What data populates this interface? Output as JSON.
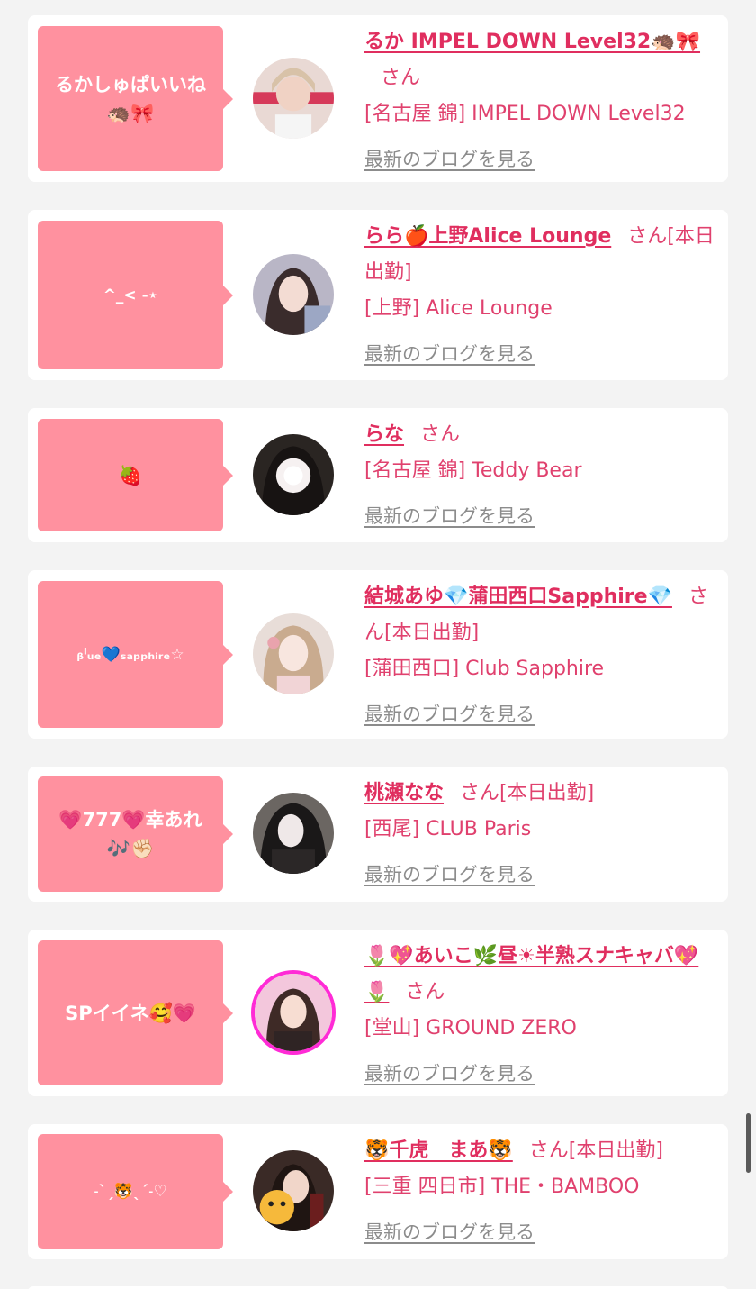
{
  "blog_link_label": "最新のブログを見る",
  "colors": {
    "background": "#f3f3f3",
    "bubble": "#ff919f",
    "name": "#e02e5f",
    "text": "#e0416e",
    "link": "#8c8c8c"
  },
  "entries": [
    {
      "comment": "るかしゅぱいいね\n🦔🎀",
      "name": "るか IMPEL DOWN Level32🦔🎀",
      "suffix": "さん",
      "shop": "[名古屋 錦] IMPEL DOWN Level32",
      "avatar_icon": "profile-photo"
    },
    {
      "comment": "^_< -⋆",
      "name": "らら🍎上野Alice Lounge",
      "suffix": "さん[本日出勤]",
      "shop": "[上野] Alice Lounge",
      "avatar_icon": "profile-photo"
    },
    {
      "comment": "🍓",
      "name": "らな",
      "suffix": "さん",
      "shop": "[名古屋 錦] Teddy Bear",
      "avatar_icon": "profile-photo"
    },
    {
      "comment": "ᵦˡᵤₑ💙ₛₐₚₚₕᵢᵣₑ☆",
      "name": "結城あゆ💎蒲田西口Sapphire💎",
      "suffix": "さん[本日出勤]",
      "shop": "[蒲田西口] Club Sapphire",
      "avatar_icon": "profile-photo"
    },
    {
      "comment": "💗777💗幸あれ\n🎶✊🏻",
      "name": "桃瀬なな",
      "suffix": "さん[本日出勤]",
      "shop": "[西尾] CLUB Paris",
      "avatar_icon": "profile-photo"
    },
    {
      "comment": "SPイイネ🥰💗",
      "name": "🌷💖あいこ🌿昼☀半熟スナキャバ💖🌷",
      "suffix": "さん",
      "shop": "[堂山] GROUND ZERO",
      "avatar_icon": "profile-photo"
    },
    {
      "comment": "˗ˋˏ🐯ˎˊ˗♡",
      "name": "🐯千虎　まあ🐯",
      "suffix": "さん[本日出勤]",
      "shop": "[三重 四日市] THE・BAMBOO",
      "avatar_icon": "profile-photo"
    }
  ]
}
